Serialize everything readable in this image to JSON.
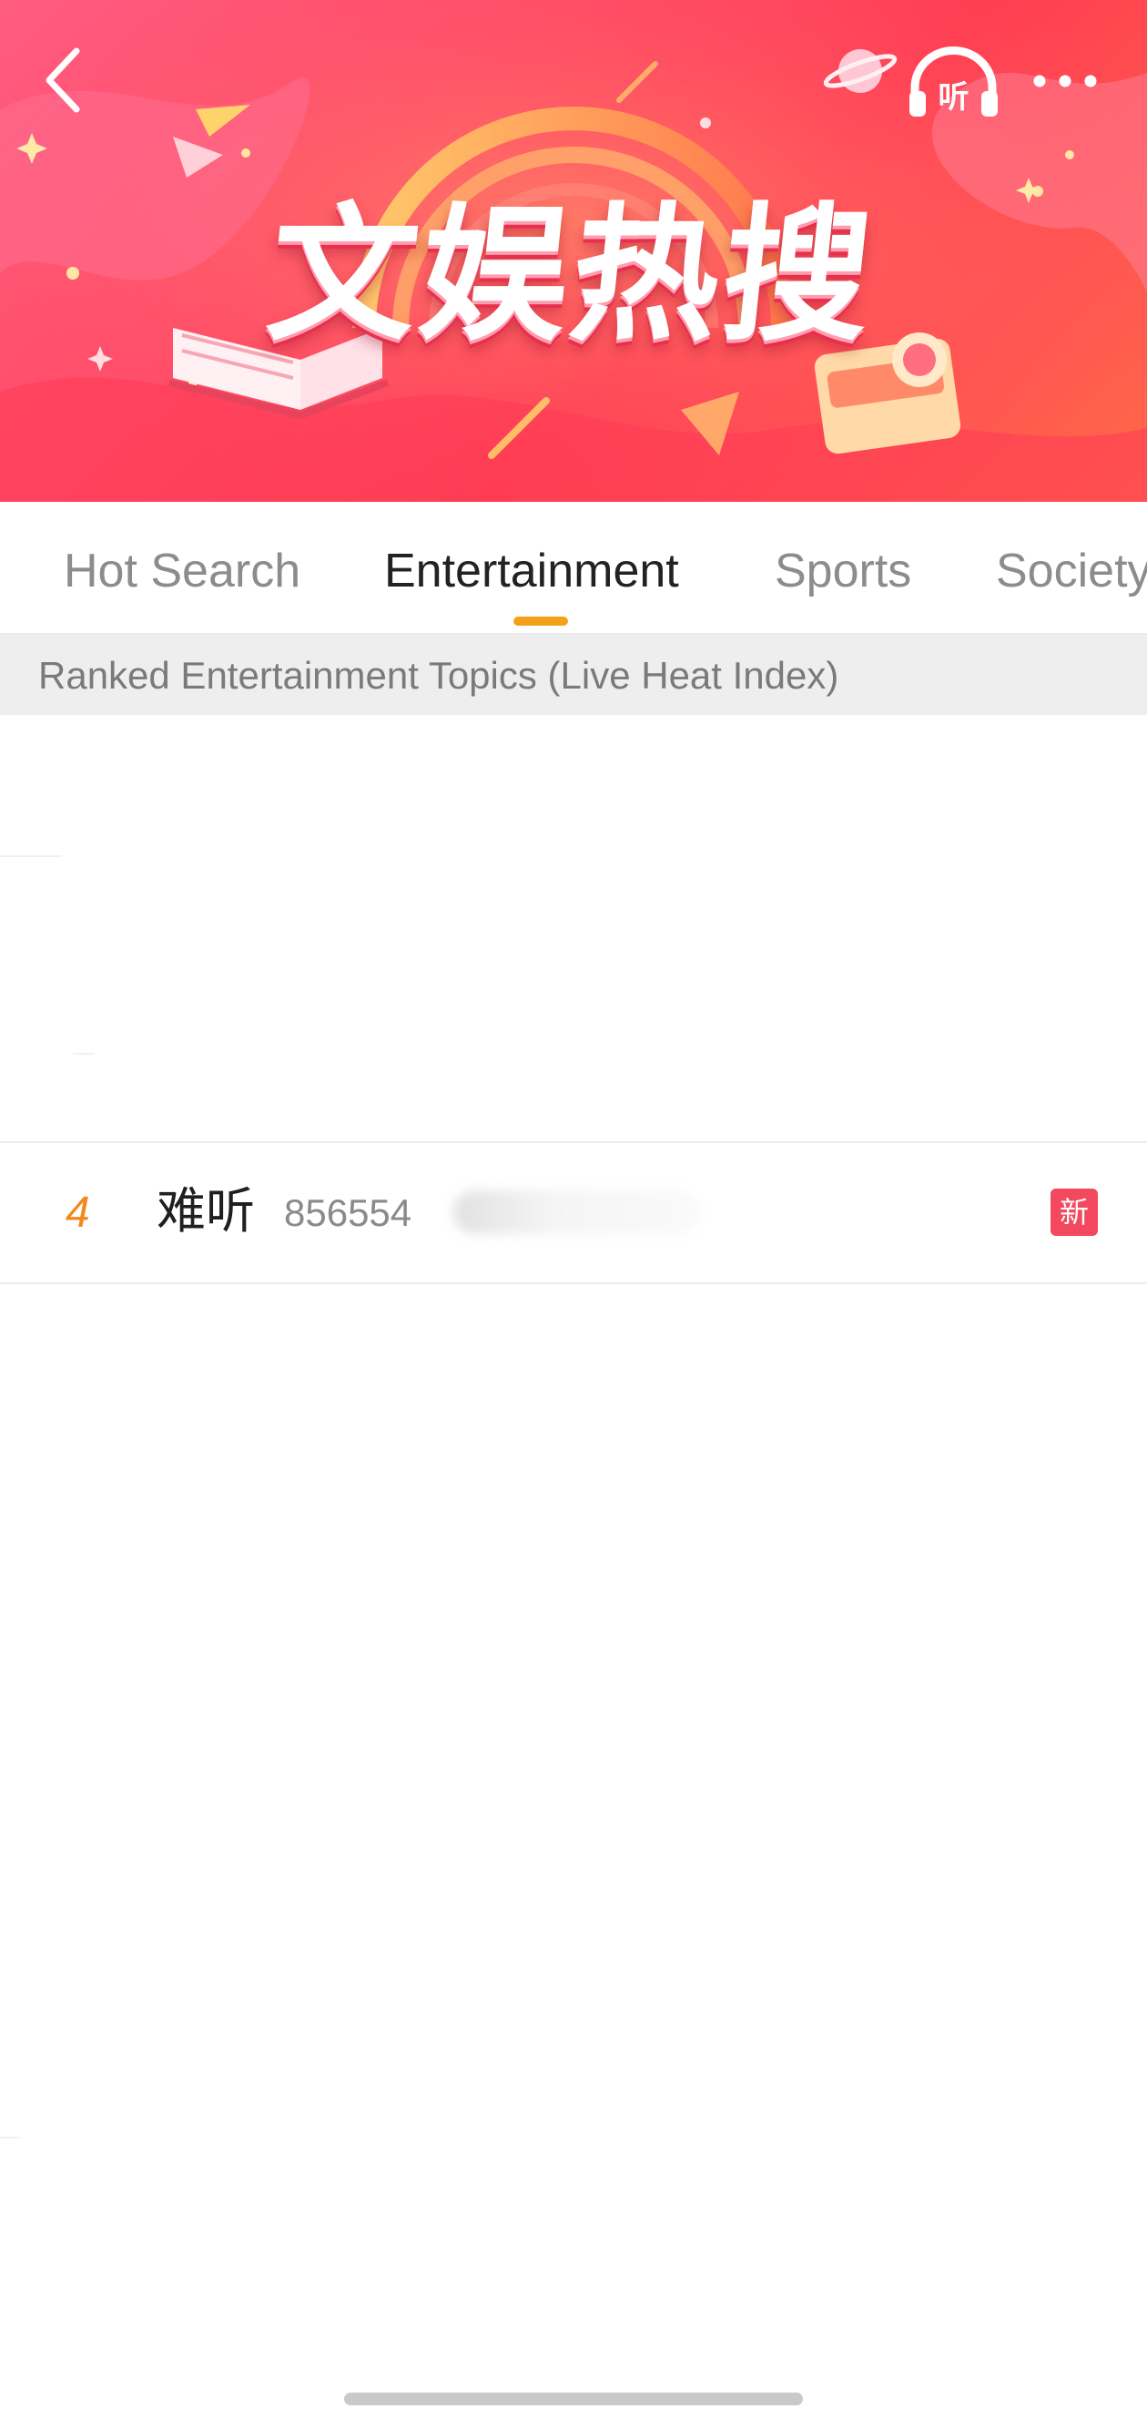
{
  "banner": {
    "title": "文娱热搜",
    "listen_icon_text": "听"
  },
  "tabs": [
    {
      "label": "Hot Search",
      "active": false
    },
    {
      "label": "Entertainment",
      "active": true
    },
    {
      "label": "Sports",
      "active": false
    },
    {
      "label": "Society",
      "active": false
    }
  ],
  "section": {
    "header": "Ranked Entertainment Topics (Live Heat Index)"
  },
  "list": {
    "items": [
      {
        "rank": "4",
        "title": "难听",
        "heat": "856554",
        "badge": "新"
      }
    ]
  },
  "colors": {
    "banner_primary": "#ff4b66",
    "tab_indicator": "#f4a11a",
    "rank": "#f08a1c",
    "badge_new": "#f2495e"
  },
  "icons": [
    "back-arrow-icon",
    "headphones-icon",
    "more-icon"
  ]
}
